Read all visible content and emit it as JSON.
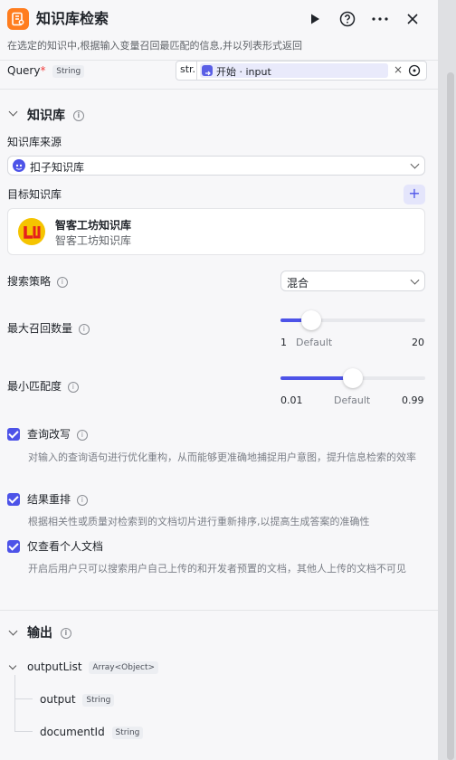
{
  "header": {
    "title": "知识库检索",
    "description": "在选定的知识中,根据输入变量召回最匹配的信息,并以列表形式返回",
    "icons": [
      "run-icon",
      "help-icon",
      "more-icon",
      "close-icon"
    ]
  },
  "input": {
    "name": "Query",
    "required_mark": "*",
    "type": "String",
    "ref_prefix": "str.",
    "ref_node": "开始",
    "ref_separator": "·",
    "ref_var": "input"
  },
  "knowledge": {
    "section_title": "知识库",
    "source_label": "知识库来源",
    "source_value": "扣子知识库",
    "target_label": "目标知识库",
    "add_symbol": "+",
    "item": {
      "name": "智客工坊知识库",
      "desc": "智客工坊知识库"
    },
    "strategy_label": "搜索策略",
    "strategy_value": "混合",
    "max_recall": {
      "label": "最大召回数量",
      "min": "1",
      "default_label": "Default",
      "max": "20",
      "value": 5
    },
    "min_match": {
      "label": "最小匹配度",
      "min": "0.01",
      "default_label": "Default",
      "max": "0.99",
      "value": 0.5
    },
    "options": [
      {
        "label": "查询改写",
        "checked": true,
        "desc": "对输入的查询语句进行优化重构，从而能够更准确地捕捉用户意图，提升信息检索的效率"
      },
      {
        "label": "结果重排",
        "checked": true,
        "desc": "根据相关性或质量对检索到的文档切片进行重新排序,以提高生成答案的准确性"
      },
      {
        "label": "仅查看个人文档",
        "checked": true,
        "desc": "开启后用户只可以搜索用户自己上传的和开发者预置的文档，其他人上传的文档不可见"
      }
    ]
  },
  "output": {
    "section_title": "输出",
    "root": {
      "name": "outputList",
      "type": "Array<Object>"
    },
    "children": [
      {
        "name": "output",
        "type": "String"
      },
      {
        "name": "documentId",
        "type": "String"
      }
    ]
  },
  "colors": {
    "accent": "#4d53e8",
    "logo_bg": "#ff7d1f"
  }
}
